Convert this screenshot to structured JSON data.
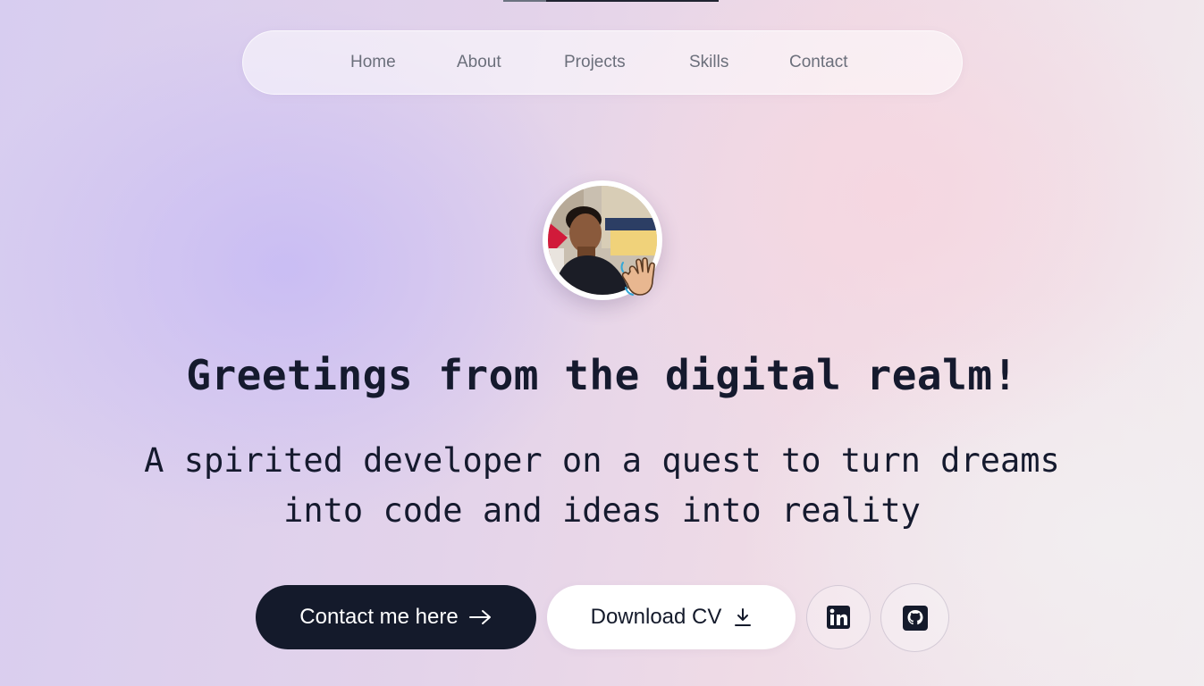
{
  "nav": {
    "items": [
      {
        "label": "Home"
      },
      {
        "label": "About"
      },
      {
        "label": "Projects"
      },
      {
        "label": "Skills"
      },
      {
        "label": "Contact"
      }
    ]
  },
  "hero": {
    "avatar_emoji": "waving-hand",
    "title": "Greetings from the digital realm!",
    "subtitle": "A spirited developer on a quest to turn dreams into code and ideas into reality"
  },
  "actions": {
    "contact_label": "Contact me here",
    "contact_icon": "arrow-right-icon",
    "download_label": "Download CV",
    "download_icon": "download-icon",
    "linkedin_icon": "linkedin-icon",
    "github_icon": "github-icon"
  },
  "colors": {
    "dark": "#141a2b",
    "nav_text": "#6b6f7b"
  }
}
